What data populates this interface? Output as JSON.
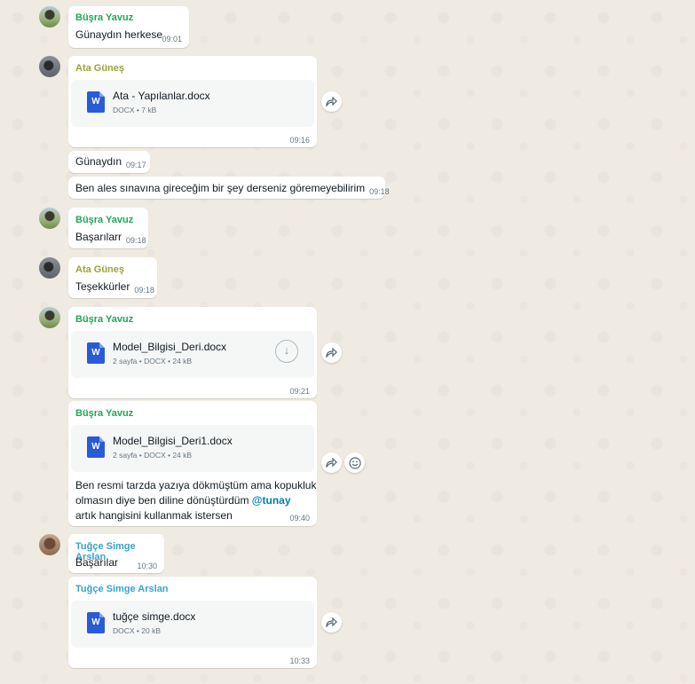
{
  "colors": {
    "background": "#efeae2",
    "bubble": "#ffffff",
    "busra": "#1fa855",
    "ata": "#9aa436",
    "tugce": "#35a3d1",
    "mention": "#027eb5",
    "doc_icon": "#2a5bd7"
  },
  "icons": {
    "forward": "forward-icon",
    "emoji": "emoji-icon",
    "download": "download-icon",
    "word": "word-doc-icon"
  },
  "messages": {
    "m1": {
      "sender": "Büşra Yavuz",
      "text": "Günaydın herkese",
      "time": "09:01"
    },
    "m2": {
      "sender": "Ata Güneş",
      "doc_name": "Ata - Yapılanlar.docx",
      "doc_meta": "DOCX • 7 kB",
      "time": "09:16"
    },
    "m3": {
      "text": "Günaydın",
      "time": "09:17"
    },
    "m4": {
      "text": "Ben ales sınavına gireceğim bir şey derseniz göremeyebilirim",
      "time": "09:18"
    },
    "m5": {
      "sender": "Büşra Yavuz",
      "text": "Başarılarr",
      "time": "09:18"
    },
    "m6": {
      "sender": "Ata Güneş",
      "text": "Teşekkürler",
      "time": "09:18"
    },
    "m7": {
      "sender": "Büşra Yavuz",
      "doc_name": "Model_Bilgisi_Deri.docx",
      "doc_meta": "2 sayfa • DOCX • 24 kB",
      "time": "09:21"
    },
    "m8": {
      "sender": "Büşra Yavuz",
      "doc_name": "Model_Bilgisi_Deri1.docx",
      "doc_meta": "2 sayfa • DOCX • 24 kB",
      "line1": "Ben resmi tarzda yazıya dökmüştüm ama kopukluk",
      "line2": "olmasın diye ben diline dönüştürdüm ",
      "mention": "@tunay",
      "line3": "artık hangisini kullanmak istersen",
      "time": "09:40"
    },
    "m9": {
      "sender": "Tuğçe Simge Arslan",
      "text": "Başarılar",
      "time": "10:30"
    },
    "m10": {
      "sender": "Tuğçe Simge Arslan",
      "doc_name": "tuğçe simge.docx",
      "doc_meta": "DOCX • 20 kB",
      "time": "10:33"
    }
  }
}
